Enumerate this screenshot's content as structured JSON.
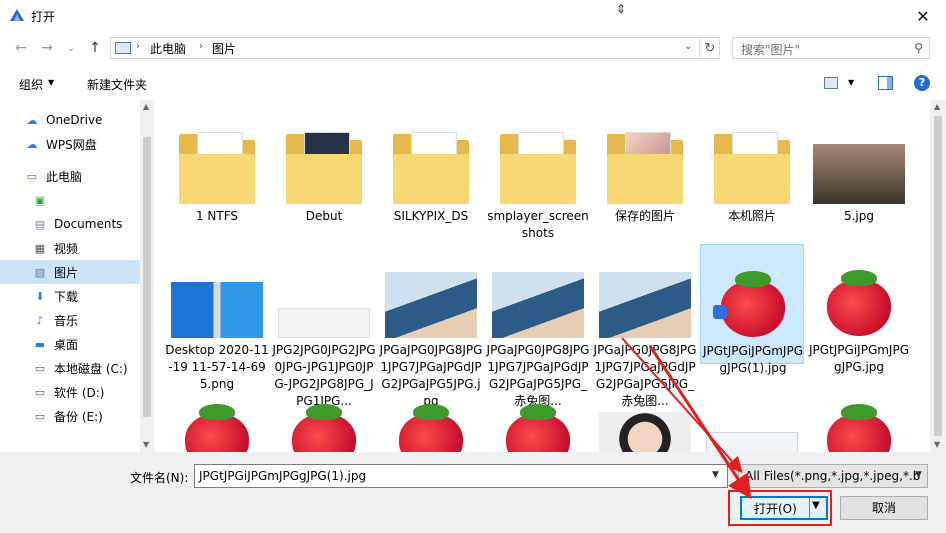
{
  "window": {
    "title": "打开",
    "close_glyph": "✕"
  },
  "nav": {
    "back": "←",
    "forward": "→",
    "recent": "⌄",
    "up": "↑",
    "breadcrumbs": [
      "此电脑",
      "图片"
    ],
    "search_placeholder": "搜索\"图片\""
  },
  "toolbar": {
    "organize": "组织",
    "new_folder": "新建文件夹",
    "help": "?"
  },
  "sidebar": {
    "items": [
      {
        "label": "OneDrive",
        "icon": "cloud-icon"
      },
      {
        "label": "WPS网盘",
        "icon": "cloud-icon"
      },
      {
        "label": "此电脑",
        "icon": "computer-icon"
      },
      {
        "label": "",
        "icon": "app-icon"
      },
      {
        "label": "Documents",
        "icon": "documents-icon"
      },
      {
        "label": "视频",
        "icon": "video-icon"
      },
      {
        "label": "图片",
        "icon": "pictures-icon",
        "selected": true
      },
      {
        "label": "下载",
        "icon": "download-icon"
      },
      {
        "label": "音乐",
        "icon": "music-icon"
      },
      {
        "label": "桌面",
        "icon": "desktop-icon"
      },
      {
        "label": "本地磁盘 (C:)",
        "icon": "drive-icon"
      },
      {
        "label": "软件 (D:)",
        "icon": "drive-icon"
      },
      {
        "label": "备份 (E:)",
        "icon": "drive-icon"
      }
    ]
  },
  "files": [
    {
      "name": "1 NTFS",
      "kind": "folder"
    },
    {
      "name": "Debut",
      "kind": "folder-dark"
    },
    {
      "name": "SILKYPIX_DS",
      "kind": "folder"
    },
    {
      "name": "smplayer_screenshots",
      "kind": "folder"
    },
    {
      "name": "保存的图片",
      "kind": "folder-face"
    },
    {
      "name": "本机照片",
      "kind": "folder"
    },
    {
      "name": "5.jpg",
      "kind": "fog"
    },
    {
      "name": "Desktop 2020-11-19 11-57-14-695.png",
      "kind": "desk"
    },
    {
      "name": "JPG2JPG0JPG2JPG0JPG-JPG1JPG0JPG-JPG2JPG8JPG_JPG1JPG...",
      "kind": "doc"
    },
    {
      "name": "JPGaJPG0JPG8JPG1JPG7JPGaJPGdJPG2JPGaJPG5JPG.jpg",
      "kind": "boy"
    },
    {
      "name": "JPGaJPG0JPG8JPG1JPG7JPGaJPGdJPG2JPGaJPG5JPG_赤兔图...",
      "kind": "boy"
    },
    {
      "name": "JPGaJPG0JPG8JPG1JPG7JPGaJPGdJPG2JPGaJPG5JPG_赤兔图...",
      "kind": "boy"
    },
    {
      "name": "JPGtJPGiJPGmJPGgJPG(1).jpg",
      "kind": "berry-badge",
      "selected": true
    },
    {
      "name": "JPGtJPGiJPGmJPGgJPG.jpg",
      "kind": "berry"
    },
    {
      "name": "",
      "kind": "berry"
    },
    {
      "name": "",
      "kind": "berry"
    },
    {
      "name": "",
      "kind": "berry"
    },
    {
      "name": "",
      "kind": "berry"
    },
    {
      "name": "",
      "kind": "girl"
    },
    {
      "name": "",
      "kind": "card"
    },
    {
      "name": "",
      "kind": "berry"
    }
  ],
  "footer": {
    "filename_label": "文件名(N):",
    "filename_value": "JPGtJPGiJPGmJPGgJPG(1).jpg",
    "filetype_value": "All Files(*.png,*.jpg,*.jpeg,*.b",
    "open_label": "打开(O)",
    "cancel_label": "取消"
  },
  "colors": {
    "accent": "#0078d7",
    "selection": "#cce8ff",
    "annotation": "#e02020"
  }
}
